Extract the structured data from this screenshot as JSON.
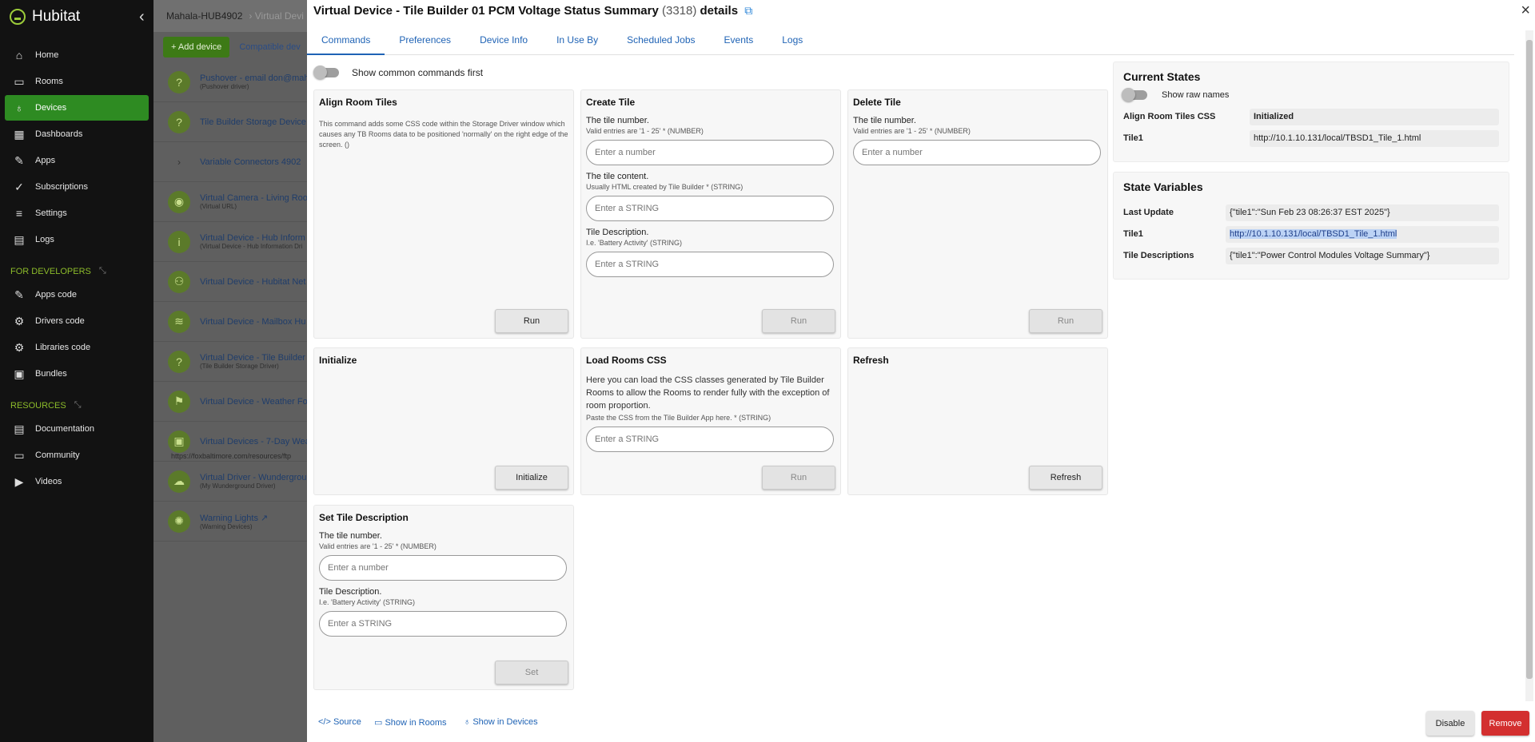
{
  "sidebar": {
    "brand": "Hubitat",
    "items": [
      {
        "label": "Home",
        "icon": "home-icon"
      },
      {
        "label": "Rooms",
        "icon": "bed-icon"
      },
      {
        "label": "Devices",
        "icon": "bulb-icon"
      },
      {
        "label": "Dashboards",
        "icon": "grid-icon"
      },
      {
        "label": "Apps",
        "icon": "tools-icon"
      },
      {
        "label": "Subscriptions",
        "icon": "check-circle-icon"
      },
      {
        "label": "Settings",
        "icon": "sliders-icon"
      },
      {
        "label": "Logs",
        "icon": "log-icon"
      }
    ],
    "dev_section": "FOR DEVELOPERS",
    "dev_items": [
      {
        "label": "Apps code"
      },
      {
        "label": "Drivers code"
      },
      {
        "label": "Libraries code"
      },
      {
        "label": "Bundles"
      }
    ],
    "res_section": "RESOURCES",
    "res_items": [
      {
        "label": "Documentation"
      },
      {
        "label": "Community"
      },
      {
        "label": "Videos"
      }
    ],
    "accent": "#2e8b22"
  },
  "bg": {
    "crumb1": "Mahala-HUB4902",
    "crumb2": "Virtual Devi",
    "add_device": "+ Add device",
    "compatible": "Compatible dev",
    "devices": [
      {
        "name": "Pushover - email don@mah",
        "sub": "(Pushover driver)"
      },
      {
        "name": "Tile Builder Storage Device",
        "sub": ""
      },
      {
        "name": "Variable Connectors 4902",
        "sub": ""
      },
      {
        "name": "Virtual Camera - Living Roo",
        "sub": "(Virtual URL)"
      },
      {
        "name": "Virtual Device - Hub Inform",
        "sub": "(Virtual Device - Hub Information Dri"
      },
      {
        "name": "Virtual Device - Hubitat Net",
        "sub": ""
      },
      {
        "name": "Virtual Device - Mailbox Hu",
        "sub": ""
      },
      {
        "name": "Virtual Device - Tile Builder",
        "sub": "(Tile Builder Storage Driver)"
      },
      {
        "name": "Virtual Device - Weather Fo",
        "sub": ""
      },
      {
        "name": "Virtual Devices - 7-Day Wea",
        "sub": ""
      },
      {
        "name": "Virtual Driver - Wundergrou",
        "sub": "(My Wunderground Driver)"
      },
      {
        "name": "Warning Lights",
        "sub": "(Warning Devices)"
      }
    ],
    "url": "https://foxbaltimore.com/resources/ftp"
  },
  "modal": {
    "title": "Virtual Device - Tile Builder 01 PCM Voltage Status Summary",
    "id": "(3318)",
    "title_suffix": "details",
    "tabs": [
      "Commands",
      "Preferences",
      "Device Info",
      "In Use By",
      "Scheduled Jobs",
      "Events",
      "Logs"
    ],
    "common_toggle": "Show common commands first",
    "commands": {
      "align": {
        "title": "Align Room Tiles",
        "desc": "This command adds some CSS code within the Storage Driver window which causes any TB Rooms data to be positioned 'normally' on the right edge of the screen. ()",
        "button": "Run"
      },
      "create": {
        "title": "Create Tile",
        "f1_label": "The tile number.",
        "f1_hint": "Valid entries are '1 - 25' * (NUMBER)",
        "f1_ph": "Enter a number",
        "f2_label": "The tile content.",
        "f2_hint": "Usually HTML created by Tile Builder * (STRING)",
        "f2_ph": "Enter a STRING",
        "f3_label": "Tile Description.",
        "f3_hint": "I.e. 'Battery Activity' (STRING)",
        "f3_ph": "Enter a STRING",
        "button": "Run"
      },
      "delete": {
        "title": "Delete Tile",
        "f1_label": "The tile number.",
        "f1_hint": "Valid entries are '1 - 25' * (NUMBER)",
        "f1_ph": "Enter a number",
        "button": "Run"
      },
      "initialize": {
        "title": "Initialize",
        "button": "Initialize"
      },
      "loadcss": {
        "title": "Load Rooms CSS",
        "desc": "Here you can load the CSS classes generated by Tile Builder Rooms to allow the Rooms to render fully with the exception of room proportion.",
        "f1_hint": "Paste the CSS from the Tile Builder App here. * (STRING)",
        "f1_ph": "Enter a STRING",
        "button": "Run"
      },
      "refresh": {
        "title": "Refresh",
        "button": "Refresh"
      },
      "setdesc": {
        "title": "Set Tile Description",
        "f1_label": "The tile number.",
        "f1_hint": "Valid entries are '1 - 25' * (NUMBER)",
        "f1_ph": "Enter a number",
        "f2_label": "Tile Description.",
        "f2_hint": "I.e. 'Battery Activity' (STRING)",
        "f2_ph": "Enter a STRING",
        "button": "Set"
      }
    },
    "current_states": {
      "title": "Current States",
      "toggle": "Show raw names",
      "rows": [
        {
          "k": "Align Room Tiles CSS",
          "v": "Initialized"
        },
        {
          "k": "Tile1",
          "v": "http://10.1.10.131/local/TBSD1_Tile_1.html"
        }
      ]
    },
    "state_variables": {
      "title": "State Variables",
      "rows": [
        {
          "k": "Last Update",
          "v": "{\"tile1\":\"Sun Feb 23 08:26:37 EST 2025\"}"
        },
        {
          "k": "Tile1",
          "v": "http://10.1.10.131/local/TBSD1_Tile_1.html"
        },
        {
          "k": "Tile Descriptions",
          "v": "{\"tile1\":\"Power Control Modules Voltage Summary\"}"
        }
      ]
    },
    "footer": {
      "source": "Source",
      "show_rooms": "Show in Rooms",
      "show_devices": "Show in Devices",
      "disable": "Disable",
      "remove": "Remove",
      "remove_color": "#d32f2f"
    }
  }
}
